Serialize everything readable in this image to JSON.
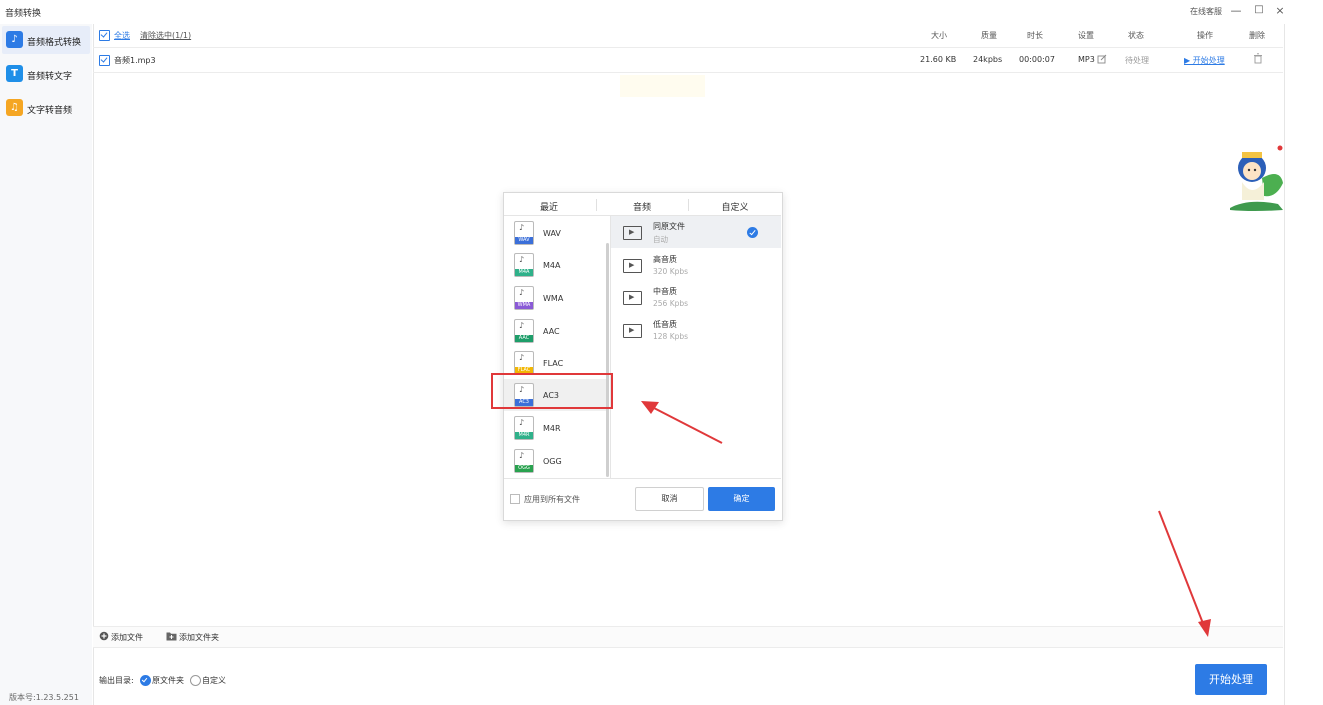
{
  "app": {
    "title": "音频转换"
  },
  "titlebar": {
    "support": "在线客服",
    "minimize": "—",
    "maximize": "□",
    "close": "×"
  },
  "sidebar": {
    "items": [
      {
        "label": "音频格式转换",
        "icon": "music-convert-icon",
        "icon_glyph": "♪",
        "color": "#2d7be5",
        "active": true
      },
      {
        "label": "音频转文字",
        "icon": "audio-to-text-icon",
        "icon_glyph": "T",
        "color": "#1f8fe8",
        "active": false
      },
      {
        "label": "文字转音频",
        "icon": "text-to-audio-icon",
        "icon_glyph": "♫",
        "color": "#f5a623",
        "active": false
      }
    ],
    "version": "版本号:1.23.5.251"
  },
  "list": {
    "select_all": "全选",
    "clear_selected": "清除选中(1/1)",
    "columns": [
      "大小",
      "质量",
      "时长",
      "设置",
      "状态",
      "操作",
      "删除"
    ],
    "rows": [
      {
        "filename": "音频1.mp3",
        "size": "21.60 KB",
        "quality": "24kpbs",
        "duration": "00:00:07",
        "format": "MP3",
        "status": "待处理",
        "action": "▶ 开始处理"
      }
    ]
  },
  "footer": {
    "add_file": "添加文件",
    "add_folder": "添加文件夹",
    "output_label": "输出目录:",
    "output_options": [
      "原文件夹",
      "自定义"
    ],
    "output_selected": "原文件夹",
    "start_button": "开始处理"
  },
  "dialog": {
    "tabs": [
      "最近",
      "音频",
      "自定义"
    ],
    "formats": [
      {
        "name": "WAV",
        "color": "#3b6fd9"
      },
      {
        "name": "M4A",
        "color": "#2fb18a"
      },
      {
        "name": "WMA",
        "color": "#8a5ad6"
      },
      {
        "name": "AAC",
        "color": "#1e9e6a"
      },
      {
        "name": "FLAC",
        "color": "#f2b705"
      },
      {
        "name": "AC3",
        "color": "#3b6fd9"
      },
      {
        "name": "M4R",
        "color": "#2fb18a"
      },
      {
        "name": "OGG",
        "color": "#29a24f"
      }
    ],
    "selected_format": "AC3",
    "qualities": [
      {
        "title": "同原文件",
        "sub": "自动"
      },
      {
        "title": "高音质",
        "sub": "320 Kpbs"
      },
      {
        "title": "中音质",
        "sub": "256 Kpbs"
      },
      {
        "title": "低音质",
        "sub": "128 Kpbs"
      }
    ],
    "selected_quality": "同原文件",
    "apply_all": "应用到所有文件",
    "cancel": "取消",
    "confirm": "确定"
  },
  "colors": {
    "accent": "#2d7be5",
    "annotation": "#e0383a"
  }
}
